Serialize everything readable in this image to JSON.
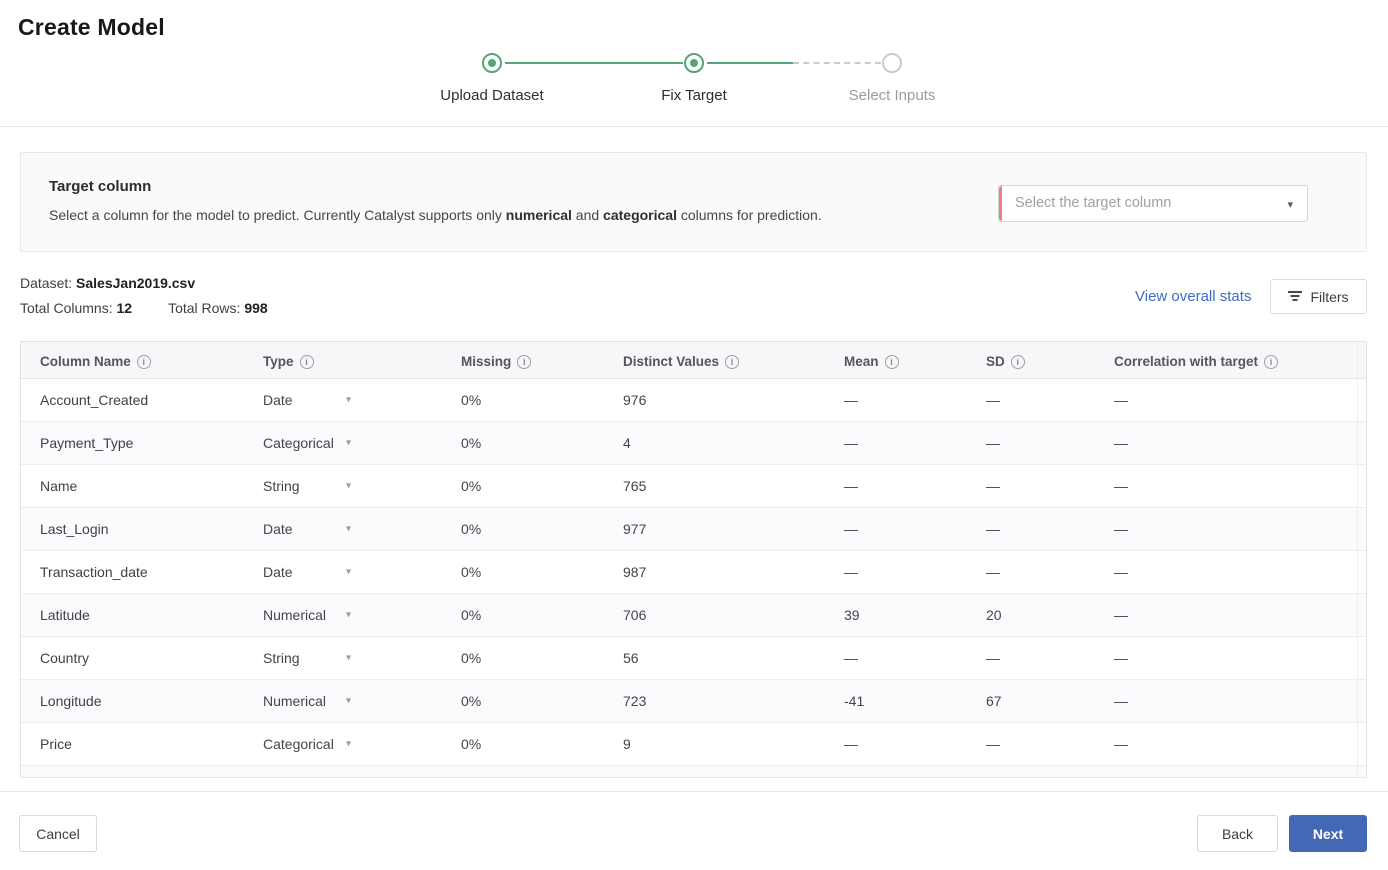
{
  "header": {
    "title": "Create Model"
  },
  "stepper": {
    "steps": [
      {
        "label": "Upload Dataset",
        "state": "complete"
      },
      {
        "label": "Fix Target",
        "state": "current"
      },
      {
        "label": "Select Inputs",
        "state": "upcoming"
      }
    ]
  },
  "target_section": {
    "title": "Target column",
    "description": {
      "part1": "Select a column for the model to predict. Currently Catalyst supports only ",
      "bold1": "numerical",
      "part2": " and ",
      "bold2": "categorical",
      "part3": " columns for prediction."
    },
    "dropdown": {
      "placeholder": "Select the target column",
      "caret": "▾"
    }
  },
  "dataset_info": {
    "dataset_label": "Dataset:",
    "dataset_name": "SalesJan2019.csv",
    "columns_label": "Total Columns:",
    "columns_value": "12",
    "rows_label": "Total Rows:",
    "rows_value": "998"
  },
  "toolbar": {
    "stats_link": "View overall stats",
    "filters_label": "Filters"
  },
  "table": {
    "columns": [
      {
        "label": "Column Name"
      },
      {
        "label": "Type"
      },
      {
        "label": "Missing"
      },
      {
        "label": "Distinct Values"
      },
      {
        "label": "Mean"
      },
      {
        "label": "SD"
      },
      {
        "label": "Correlation with target"
      }
    ],
    "type_caret": "▾",
    "rows": [
      {
        "name": "Account_Created",
        "type": "Date",
        "missing": "0%",
        "distinct": "976",
        "mean": "—",
        "sd": "—",
        "correlation": "—"
      },
      {
        "name": "Payment_Type",
        "type": "Categorical",
        "missing": "0%",
        "distinct": "4",
        "mean": "—",
        "sd": "—",
        "correlation": "—"
      },
      {
        "name": "Name",
        "type": "String",
        "missing": "0%",
        "distinct": "765",
        "mean": "—",
        "sd": "—",
        "correlation": "—"
      },
      {
        "name": "Last_Login",
        "type": "Date",
        "missing": "0%",
        "distinct": "977",
        "mean": "—",
        "sd": "—",
        "correlation": "—"
      },
      {
        "name": "Transaction_date",
        "type": "Date",
        "missing": "0%",
        "distinct": "987",
        "mean": "—",
        "sd": "—",
        "correlation": "—"
      },
      {
        "name": "Latitude",
        "type": "Numerical",
        "missing": "0%",
        "distinct": "706",
        "mean": "39",
        "sd": "20",
        "correlation": "—"
      },
      {
        "name": "Country",
        "type": "String",
        "missing": "0%",
        "distinct": "56",
        "mean": "—",
        "sd": "—",
        "correlation": "—"
      },
      {
        "name": "Longitude",
        "type": "Numerical",
        "missing": "0%",
        "distinct": "723",
        "mean": "-41",
        "sd": "67",
        "correlation": "—"
      },
      {
        "name": "Price",
        "type": "Categorical",
        "missing": "0%",
        "distinct": "9",
        "mean": "—",
        "sd": "—",
        "correlation": "—"
      }
    ]
  },
  "footer": {
    "cancel_label": "Cancel",
    "back_label": "Back",
    "next_label": "Next"
  },
  "colors": {
    "accent_green": "#56a478",
    "inactive_gray": "#c9cccf",
    "link_blue": "#3b6dc9",
    "primary_blue": "#4368b5",
    "required_red": "#e9827a"
  }
}
